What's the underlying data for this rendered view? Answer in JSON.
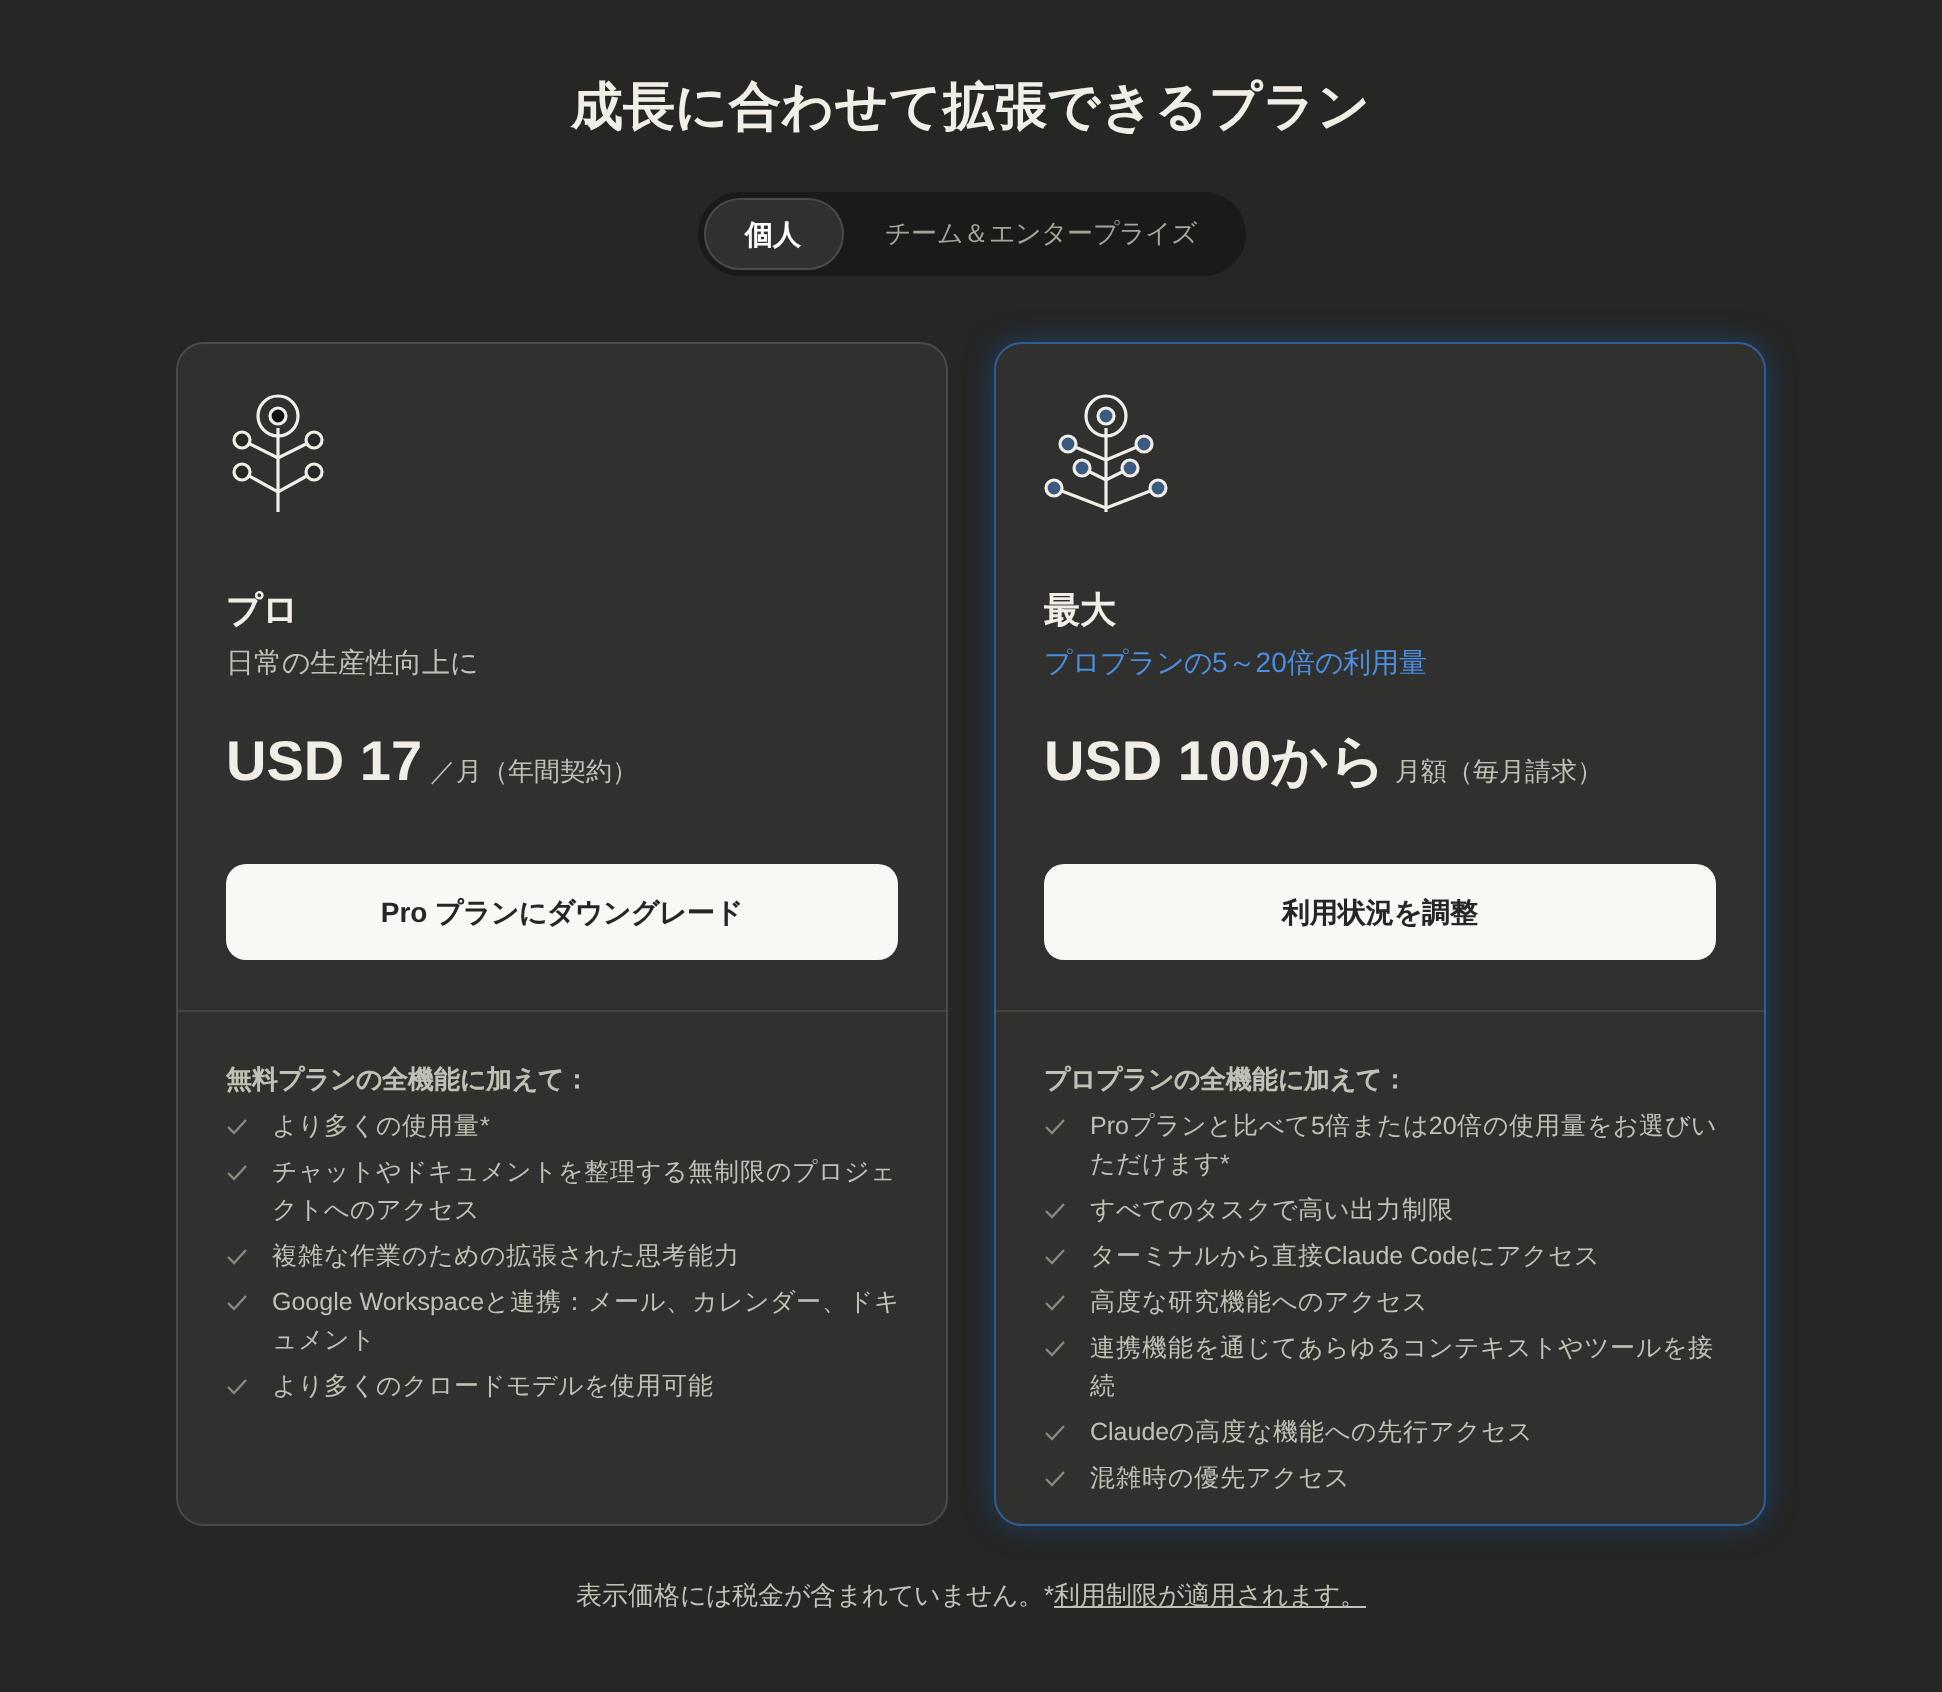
{
  "title": "成長に合わせて拡張できるプラン",
  "tabs": [
    {
      "label": "個人",
      "selected": true
    },
    {
      "label": "チーム＆エンタープライズ",
      "selected": false
    }
  ],
  "plans": [
    {
      "kind": "small",
      "highlighted": false,
      "name": "プロ",
      "subtitle": "日常の生産性向上に",
      "price": "USD 17",
      "price_note": "／月（年間契約）",
      "button": "Pro プランにダウングレード",
      "features_heading": "無料プランの全機能に加えて：",
      "features": [
        "より多くの使用量*",
        "チャットやドキュメントを整理する無制限のプロジェクトへのアクセス",
        "複雑な作業のための拡張された思考能力",
        "Google Workspaceと連携：メール、カレンダー、ドキュメント",
        "より多くのクロードモデルを使用可能"
      ]
    },
    {
      "kind": "large",
      "highlighted": true,
      "name": "最大",
      "subtitle": "プロプランの5～20倍の利用量",
      "price": "USD 100から",
      "price_note": "月額（毎月請求）",
      "button": "利用状況を調整",
      "features_heading": "プロプランの全機能に加えて：",
      "features": [
        "Proプランと比べて5倍または20倍の使用量をお選びいただけます*",
        "すべてのタスクで高い出力制限",
        "ターミナルから直接Claude Codeにアクセス",
        "高度な研究機能へのアクセス",
        "連携機能を通じてあらゆるコンテキストやツールを接続",
        "Claudeの高度な機能への先行アクセス",
        "混雑時の優先アクセス"
      ]
    }
  ],
  "footer": {
    "text": "表示価格には税金が含まれていません。*",
    "link": "利用制限が適用されます。"
  }
}
